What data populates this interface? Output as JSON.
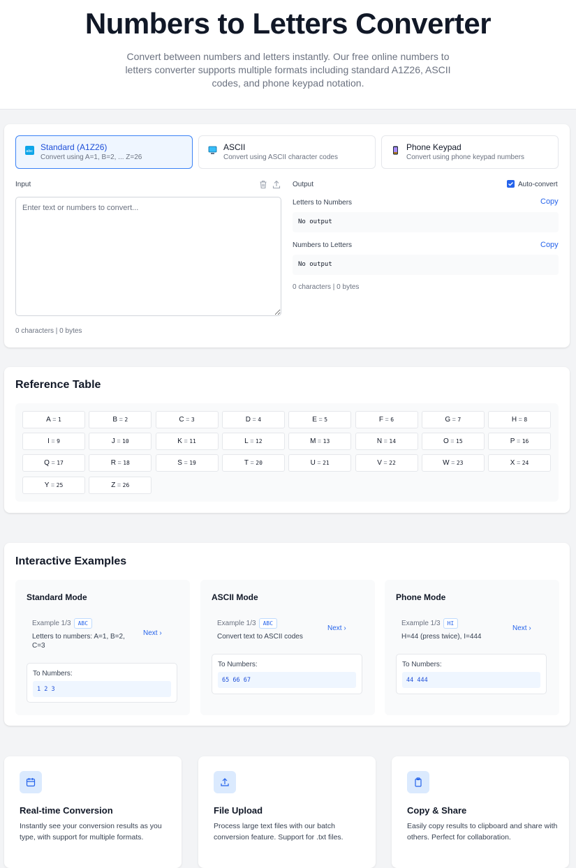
{
  "hero": {
    "title": "Numbers to Letters Converter",
    "subtitle": "Convert between numbers and letters instantly. Our free online numbers to letters converter supports multiple formats including standard A1Z26, ASCII codes, and phone keypad notation."
  },
  "modes": [
    {
      "title": "Standard (A1Z26)",
      "desc": "Convert using A=1, B=2, ... Z=26",
      "icon": "abc-icon",
      "active": true
    },
    {
      "title": "ASCII",
      "desc": "Convert using ASCII character codes",
      "icon": "computer-icon",
      "active": false
    },
    {
      "title": "Phone Keypad",
      "desc": "Convert using phone keypad numbers",
      "icon": "phone-icon",
      "active": false
    }
  ],
  "input": {
    "label": "Input",
    "placeholder": "Enter text or numbers to convert...",
    "value": "",
    "stats": "0 characters | 0 bytes"
  },
  "output": {
    "label": "Output",
    "auto_convert_label": "Auto-convert",
    "auto_convert": true,
    "letters_to_numbers_label": "Letters to Numbers",
    "letters_to_numbers_value": "No output",
    "numbers_to_letters_label": "Numbers to Letters",
    "numbers_to_letters_value": "No output",
    "copy_label": "Copy",
    "stats": "0 characters | 0 bytes"
  },
  "reference": {
    "title": "Reference Table",
    "items": [
      {
        "l": "A",
        "n": "1"
      },
      {
        "l": "B",
        "n": "2"
      },
      {
        "l": "C",
        "n": "3"
      },
      {
        "l": "D",
        "n": "4"
      },
      {
        "l": "E",
        "n": "5"
      },
      {
        "l": "F",
        "n": "6"
      },
      {
        "l": "G",
        "n": "7"
      },
      {
        "l": "H",
        "n": "8"
      },
      {
        "l": "I",
        "n": "9"
      },
      {
        "l": "J",
        "n": "10"
      },
      {
        "l": "K",
        "n": "11"
      },
      {
        "l": "L",
        "n": "12"
      },
      {
        "l": "M",
        "n": "13"
      },
      {
        "l": "N",
        "n": "14"
      },
      {
        "l": "O",
        "n": "15"
      },
      {
        "l": "P",
        "n": "16"
      },
      {
        "l": "Q",
        "n": "17"
      },
      {
        "l": "R",
        "n": "18"
      },
      {
        "l": "S",
        "n": "19"
      },
      {
        "l": "T",
        "n": "20"
      },
      {
        "l": "U",
        "n": "21"
      },
      {
        "l": "V",
        "n": "22"
      },
      {
        "l": "W",
        "n": "23"
      },
      {
        "l": "X",
        "n": "24"
      },
      {
        "l": "Y",
        "n": "25"
      },
      {
        "l": "Z",
        "n": "26"
      }
    ]
  },
  "examples": {
    "title": "Interactive Examples",
    "next_label": "Next",
    "cards": [
      {
        "title": "Standard Mode",
        "counter": "Example 1/3",
        "badge": "ABC",
        "desc": "Letters to numbers: A=1, B=2, C=3",
        "result_label": "To Numbers:",
        "result": "1 2 3"
      },
      {
        "title": "ASCII Mode",
        "counter": "Example 1/3",
        "badge": "ABC",
        "desc": "Convert text to ASCII codes",
        "result_label": "To Numbers:",
        "result": "65 66 67"
      },
      {
        "title": "Phone Mode",
        "counter": "Example 1/3",
        "badge": "HI",
        "desc": "H=44 (press twice), I=444",
        "result_label": "To Numbers:",
        "result": "44 444"
      }
    ]
  },
  "features": [
    {
      "title": "Real-time Conversion",
      "desc": "Instantly see your conversion results as you type, with support for multiple formats.",
      "icon": "calendar-icon"
    },
    {
      "title": "File Upload",
      "desc": "Process large text files with our batch conversion feature. Support for .txt files.",
      "icon": "upload-icon"
    },
    {
      "title": "Copy & Share",
      "desc": "Easily copy results to clipboard and share with others. Perfect for collaboration.",
      "icon": "clipboard-icon"
    }
  ],
  "colors": {
    "accent": "#2563eb",
    "accent_light": "#eff6ff",
    "border": "#e5e7eb"
  }
}
